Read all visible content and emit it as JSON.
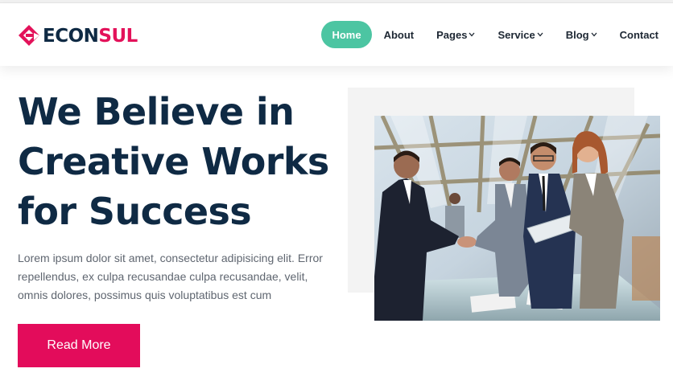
{
  "brand": {
    "logo_text_1": "ECON",
    "logo_text_2": "SUL",
    "logo_color": "#e3125a",
    "text_color": "#0f2a44"
  },
  "nav": {
    "items": [
      {
        "label": "Home",
        "active": true
      },
      {
        "label": "About"
      },
      {
        "label": "Pages",
        "has_dropdown": true
      },
      {
        "label": "Service",
        "has_dropdown": true
      },
      {
        "label": "Blog",
        "has_dropdown": true
      },
      {
        "label": "Contact"
      }
    ],
    "active_color": "#4cc5a2",
    "dropdown_icon": "chevron-down-icon"
  },
  "hero": {
    "title_lines": [
      "We Believe in",
      "Creative Works",
      "for Success"
    ],
    "description_lines": [
      "Lorem ipsum dolor sit amet, consectetur adipisicing elit. Error",
      "repellendus, ex culpa recusandae culpa recusandae, velit,",
      "omnis dolores, possimus quis voluptatibus est cum"
    ],
    "button_label": "Read More",
    "button_color": "#e30c5b"
  },
  "image": {
    "subject": "business-meeting-handshake-photo"
  }
}
